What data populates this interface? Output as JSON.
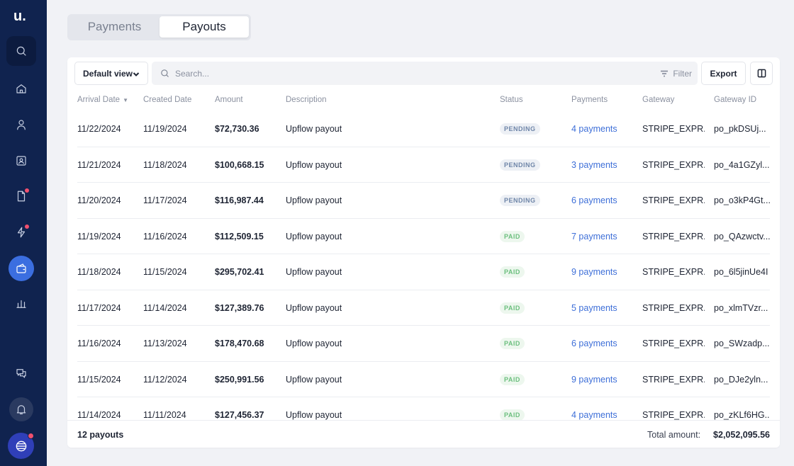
{
  "app": {
    "logo": "u."
  },
  "sidebar": {
    "items": [
      {
        "icon": "search-icon"
      },
      {
        "icon": "home-icon"
      },
      {
        "icon": "user-icon"
      },
      {
        "icon": "contact-card-icon"
      },
      {
        "icon": "document-icon",
        "notification": true
      },
      {
        "icon": "bolt-icon",
        "notification": true
      },
      {
        "icon": "wallet-icon",
        "active": true
      },
      {
        "icon": "bar-chart-icon"
      },
      {
        "icon": "chat-icon"
      },
      {
        "icon": "bell-icon"
      }
    ],
    "accent": "#3b6ee0",
    "background": "#10234f"
  },
  "tabs": [
    {
      "label": "Payments",
      "selected": false
    },
    {
      "label": "Payouts",
      "selected": true
    }
  ],
  "toolbar": {
    "view_label": "Default view",
    "search_placeholder": "Search...",
    "filter_label": "Filter",
    "export_label": "Export"
  },
  "table": {
    "columns": [
      "Arrival Date",
      "Created Date",
      "Amount",
      "Description",
      "Status",
      "Payments",
      "Gateway",
      "Gateway ID"
    ],
    "sort_indicator": "▼",
    "rows": [
      {
        "arrival": "11/22/2024",
        "created": "11/19/2024",
        "amount": "$72,730.36",
        "description": "Upflow payout",
        "status": "PENDING",
        "payments": "4 payments",
        "gateway": "STRIPE_EXPR...",
        "gateway_id": "po_pkDSUj..."
      },
      {
        "arrival": "11/21/2024",
        "created": "11/18/2024",
        "amount": "$100,668.15",
        "description": "Upflow payout",
        "status": "PENDING",
        "payments": "3 payments",
        "gateway": "STRIPE_EXPR...",
        "gateway_id": "po_4a1GZyl..."
      },
      {
        "arrival": "11/20/2024",
        "created": "11/17/2024",
        "amount": "$116,987.44",
        "description": "Upflow payout",
        "status": "PENDING",
        "payments": "6 payments",
        "gateway": "STRIPE_EXPR...",
        "gateway_id": "po_o3kP4Gt..."
      },
      {
        "arrival": "11/19/2024",
        "created": "11/16/2024",
        "amount": "$112,509.15",
        "description": "Upflow payout",
        "status": "PAID",
        "payments": "7 payments",
        "gateway": "STRIPE_EXPR...",
        "gateway_id": "po_QAzwctv..."
      },
      {
        "arrival": "11/18/2024",
        "created": "11/15/2024",
        "amount": "$295,702.41",
        "description": "Upflow payout",
        "status": "PAID",
        "payments": "9 payments",
        "gateway": "STRIPE_EXPR...",
        "gateway_id": "po_6l5jinUe4I"
      },
      {
        "arrival": "11/17/2024",
        "created": "11/14/2024",
        "amount": "$127,389.76",
        "description": "Upflow payout",
        "status": "PAID",
        "payments": "5 payments",
        "gateway": "STRIPE_EXPR...",
        "gateway_id": "po_xlmTVzr..."
      },
      {
        "arrival": "11/16/2024",
        "created": "11/13/2024",
        "amount": "$178,470.68",
        "description": "Upflow payout",
        "status": "PAID",
        "payments": "6 payments",
        "gateway": "STRIPE_EXPR...",
        "gateway_id": "po_SWzadp..."
      },
      {
        "arrival": "11/15/2024",
        "created": "11/12/2024",
        "amount": "$250,991.56",
        "description": "Upflow payout",
        "status": "PAID",
        "payments": "9 payments",
        "gateway": "STRIPE_EXPR...",
        "gateway_id": "po_DJe2yln..."
      },
      {
        "arrival": "11/14/2024",
        "created": "11/11/2024",
        "amount": "$127,456.37",
        "description": "Upflow payout",
        "status": "PAID",
        "payments": "4 payments",
        "gateway": "STRIPE_EXPR...",
        "gateway_id": "po_zKLf6HG..."
      }
    ]
  },
  "footer": {
    "count_label": "12 payouts",
    "total_label": "Total amount:",
    "total_value": "$2,052,095.56"
  },
  "colors": {
    "link": "#3e6fd8",
    "pending_badge": "#6e85a8",
    "paid_badge": "#6cbf7e",
    "notification_dot": "#f0506e"
  }
}
